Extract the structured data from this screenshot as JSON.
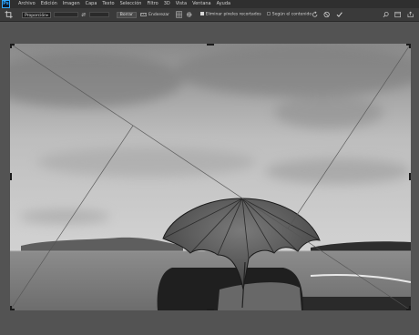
{
  "app": {
    "logo": "Ps"
  },
  "menu": [
    "Archivo",
    "Edición",
    "Imagen",
    "Capa",
    "Texto",
    "Selección",
    "Filtro",
    "3D",
    "Vista",
    "Ventana",
    "Ayuda"
  ],
  "options": {
    "ratio_value": "Proporción",
    "clear_button": "Borrar",
    "straighten_label": "Enderezar",
    "delete_pixels_label": "Eliminar píxeles recortados",
    "delete_pixels_checked": true,
    "content_aware_label": "Según el contenido",
    "content_aware_checked": false
  },
  "icons": {
    "crop": "crop-icon",
    "swap": "swap-icon",
    "straighten": "straighten-icon",
    "overlay": "overlay-grid-icon",
    "settings": "gear-icon",
    "reset": "reset-icon",
    "cancel": "cancel-icon",
    "commit": "checkmark-icon",
    "search": "search-icon",
    "workspace": "workspace-icon",
    "share": "share-icon"
  },
  "canvas": {
    "image_description_name": "black-and-white photo of umbrella by the sea",
    "overlay": "diagonal"
  }
}
